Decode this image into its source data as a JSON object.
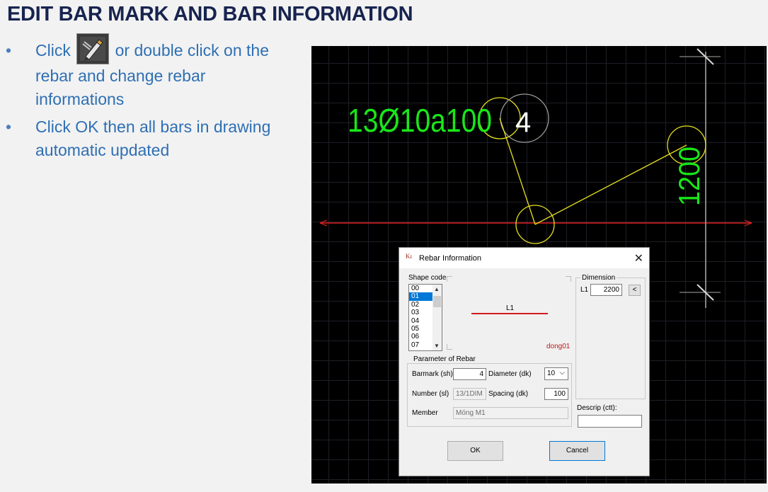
{
  "slide": {
    "title": "EDIT BAR MARK AND BAR INFORMATION",
    "bullets": [
      {
        "before_icon": "Click",
        "icon": "edit-rebar-tool-icon",
        "after_icon": "or double click on the rebar and change rebar informations"
      },
      {
        "text": "Click OK then all bars in drawing automatic updated"
      }
    ],
    "bullet_glyph": "•"
  },
  "drawing": {
    "bar_label": "13Ø10a100",
    "bar_mark": "4",
    "dimension_text": "1200",
    "colors": {
      "background": "#000000",
      "grid": "#1e1e26",
      "bar_label": "#19e619",
      "leader": "#e6e01f",
      "axis": "#e02020",
      "dim_line": "#a8a8a8"
    }
  },
  "dialog": {
    "logo": "Kɪ",
    "title": "Rebar Information",
    "close_glyph": "✕",
    "shape_code": {
      "label": "Shape code",
      "items": [
        "00",
        "01",
        "02",
        "03",
        "04",
        "05",
        "06",
        "07"
      ],
      "selected": "01",
      "preview_label": "L1",
      "preview_name": "dong01"
    },
    "dimension": {
      "label": "Dimension",
      "l1_label": "L1",
      "l1_value": "2200",
      "pick_button": "<"
    },
    "parameters": {
      "label": "Parameter of Rebar",
      "barmark_label": "Barmark (sh)",
      "barmark_value": "4",
      "diameter_label": "Diameter (dk)",
      "diameter_value": "10",
      "number_label": "Number (sl)",
      "number_value": "13/1DIM",
      "spacing_label": "Spacing (dk)",
      "spacing_value": "100",
      "member_label": "Member",
      "member_value": "Móng M1"
    },
    "descrip": {
      "label": "Descrip (ctt):",
      "value": ""
    },
    "ok_label": "OK",
    "cancel_label": "Cancel",
    "colors": {
      "selection": "#0078d7",
      "preview_line": "#d21c1c",
      "preview_name": "#c01818"
    }
  }
}
